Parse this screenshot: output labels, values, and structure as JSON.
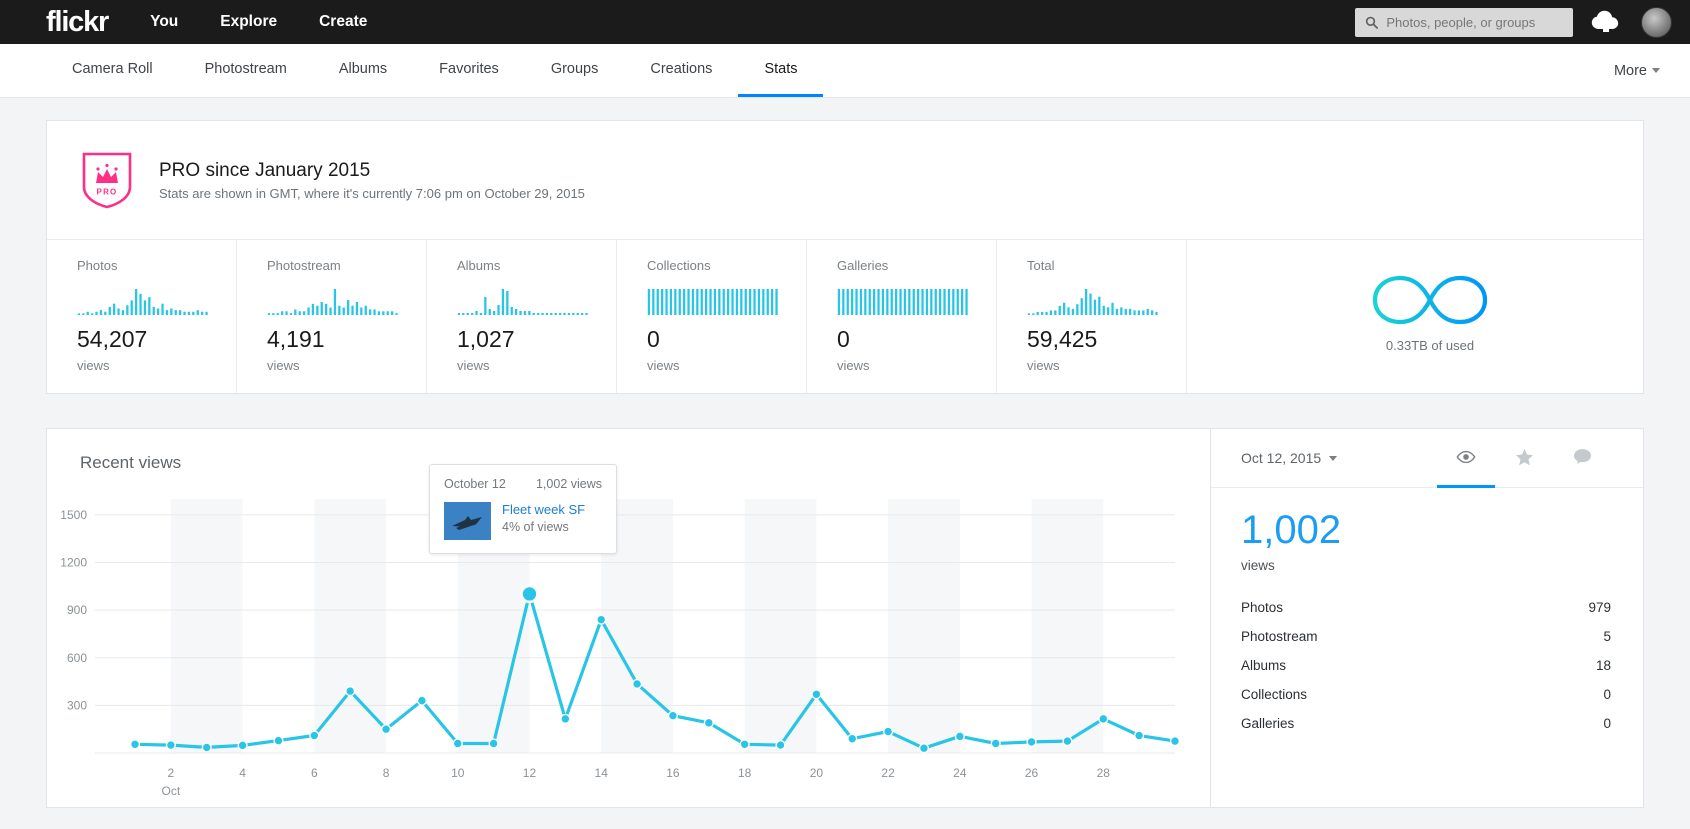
{
  "header": {
    "logo": "flickr",
    "nav": [
      {
        "label": "You"
      },
      {
        "label": "Explore"
      },
      {
        "label": "Create"
      }
    ],
    "search": {
      "placeholder": "Photos, people, or groups",
      "value": ""
    },
    "icons": {
      "search": "search-icon",
      "upload": "upload-cloud-icon",
      "avatar": "user-avatar"
    }
  },
  "subnav": {
    "items": [
      {
        "label": "Camera Roll",
        "active": false
      },
      {
        "label": "Photostream",
        "active": false
      },
      {
        "label": "Albums",
        "active": false
      },
      {
        "label": "Favorites",
        "active": false
      },
      {
        "label": "Groups",
        "active": false
      },
      {
        "label": "Creations",
        "active": false
      },
      {
        "label": "Stats",
        "active": true
      }
    ],
    "more_label": "More"
  },
  "pro": {
    "title": "PRO since January 2015",
    "subtitle": "Stats are shown in GMT, where it's currently 7:06 pm on October 29, 2015",
    "badge_text": "PRO",
    "badge_color": "#ff2e87"
  },
  "stat_cards": [
    {
      "label": "Photos",
      "value": "54,207",
      "sub": "views",
      "spark": [
        1,
        1,
        2,
        1,
        2,
        3,
        2,
        5,
        7,
        4,
        3,
        6,
        9,
        16,
        13,
        9,
        11,
        5,
        4,
        7,
        3,
        4,
        3,
        3,
        2,
        2,
        2,
        3,
        2,
        2
      ]
    },
    {
      "label": "Photostream",
      "value": "4,191",
      "sub": "views",
      "spark": [
        1,
        1,
        1,
        2,
        2,
        1,
        3,
        2,
        2,
        4,
        6,
        5,
        7,
        6,
        4,
        14,
        5,
        4,
        8,
        5,
        7,
        4,
        5,
        3,
        3,
        2,
        2,
        2,
        2,
        1
      ]
    },
    {
      "label": "Albums",
      "value": "1,027",
      "sub": "views",
      "spark": [
        1,
        1,
        1,
        1,
        2,
        1,
        9,
        3,
        2,
        5,
        13,
        12,
        4,
        3,
        2,
        2,
        2,
        1,
        1,
        1,
        1,
        1,
        1,
        1,
        1,
        1,
        1,
        1,
        1,
        1
      ]
    },
    {
      "label": "Collections",
      "value": "0",
      "sub": "views",
      "spark": [
        1,
        1,
        1,
        1,
        1,
        1,
        1,
        1,
        1,
        1,
        1,
        1,
        1,
        1,
        1,
        1,
        1,
        1,
        1,
        1,
        1,
        1,
        1,
        1,
        1,
        1,
        1,
        1,
        1,
        1
      ]
    },
    {
      "label": "Galleries",
      "value": "0",
      "sub": "views",
      "spark": [
        1,
        1,
        1,
        1,
        1,
        1,
        1,
        1,
        1,
        1,
        1,
        1,
        1,
        1,
        1,
        1,
        1,
        1,
        1,
        1,
        1,
        1,
        1,
        1,
        1,
        1,
        1,
        1,
        1,
        1
      ]
    },
    {
      "label": "Total",
      "value": "59,425",
      "sub": "views",
      "spark": [
        1,
        1,
        2,
        2,
        2,
        3,
        3,
        6,
        8,
        5,
        4,
        7,
        11,
        17,
        14,
        10,
        12,
        6,
        5,
        8,
        4,
        5,
        4,
        4,
        3,
        3,
        3,
        4,
        3,
        2
      ]
    }
  ],
  "storage": {
    "label": "0.33TB of used",
    "icon": "infinity-icon",
    "gradient_from": "#19d3d3",
    "gradient_to": "#0095f8"
  },
  "recent_views": {
    "title": "Recent views",
    "date_label": "Oct 12, 2015",
    "metric_tabs": [
      {
        "icon": "eye-icon",
        "active": true
      },
      {
        "icon": "star-icon",
        "active": false
      },
      {
        "icon": "comment-icon",
        "active": false
      }
    ],
    "selected_value": "1,002",
    "selected_sub": "views",
    "breakdown": [
      {
        "label": "Photos",
        "value": "979"
      },
      {
        "label": "Photostream",
        "value": "5"
      },
      {
        "label": "Albums",
        "value": "18"
      },
      {
        "label": "Collections",
        "value": "0"
      },
      {
        "label": "Galleries",
        "value": "0"
      }
    ]
  },
  "tooltip": {
    "date": "October 12",
    "views": "1,002 views",
    "photo_title": "Fleet week SF",
    "photo_share": "4% of views",
    "thumb": "airplane-thumbnail"
  },
  "chart_data": {
    "type": "line",
    "title": "Recent views",
    "xlabel": "Oct",
    "ylabel": "",
    "ylim": [
      0,
      1600
    ],
    "yticks": [
      300,
      600,
      900,
      1200,
      1500
    ],
    "xticks": [
      "2",
      "4",
      "6",
      "8",
      "10",
      "12",
      "14",
      "16",
      "18",
      "20",
      "22",
      "24",
      "26",
      "28"
    ],
    "x_axis_caption": "Oct",
    "grid": true,
    "legend": "none",
    "line_color": "#29c5e6",
    "highlight_index": 11,
    "highlight_value": 1002,
    "x": [
      1,
      2,
      3,
      4,
      5,
      6,
      7,
      8,
      9,
      10,
      11,
      12,
      13,
      14,
      15,
      16,
      17,
      18,
      19,
      20,
      21,
      22,
      23,
      24,
      25,
      26,
      27,
      28,
      29,
      30
    ],
    "values": [
      55,
      50,
      35,
      48,
      78,
      110,
      390,
      150,
      330,
      60,
      60,
      1002,
      215,
      840,
      435,
      235,
      190,
      55,
      50,
      370,
      90,
      135,
      30,
      105,
      60,
      70,
      75,
      215,
      110,
      75
    ]
  }
}
